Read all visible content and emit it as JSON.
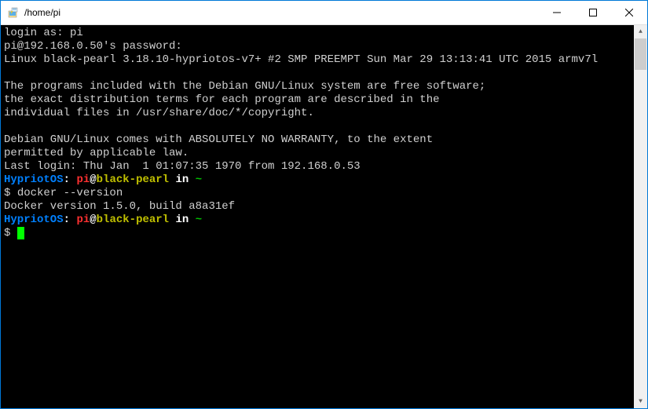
{
  "window": {
    "title": "/home/pi"
  },
  "terminal": {
    "login_prompt": "login as: pi",
    "password_prompt": "pi@192.168.0.50's password:",
    "kernel_line": "Linux black-pearl 3.18.10-hypriotos-v7+ #2 SMP PREEMPT Sun Mar 29 13:13:41 UTC 2015 armv7l",
    "motd_line1": "The programs included with the Debian GNU/Linux system are free software;",
    "motd_line2": "the exact distribution terms for each program are described in the",
    "motd_line3": "individual files in /usr/share/doc/*/copyright.",
    "motd_line4": "Debian GNU/Linux comes with ABSOLUTELY NO WARRANTY, to the extent",
    "motd_line5": "permitted by applicable law.",
    "last_login": "Last login: Thu Jan  1 01:07:35 1970 from 192.168.0.53",
    "ps1_os": "HypriotOS",
    "ps1_sep": ": ",
    "ps1_user": "pi",
    "ps1_at": "@",
    "ps1_host": "black-pearl",
    "ps1_in": " in ",
    "ps1_path": "~",
    "prompt_symbol": "$ ",
    "command1": "docker --version",
    "output1": "Docker version 1.5.0, build a8a31ef"
  }
}
